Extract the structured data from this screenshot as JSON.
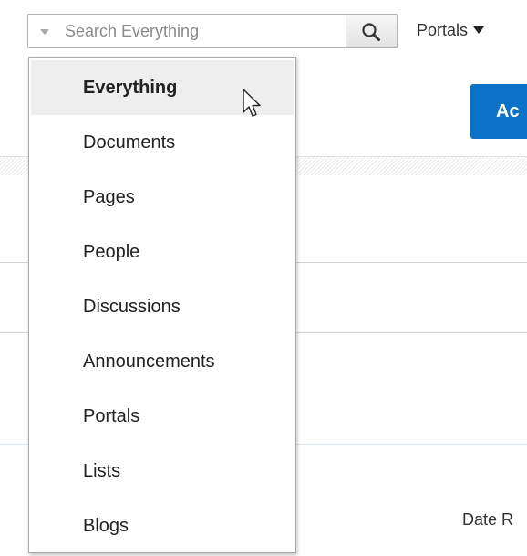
{
  "search": {
    "placeholder": "Search Everything",
    "value": ""
  },
  "portals_menu": {
    "label": "Portals"
  },
  "action_button": {
    "label": "Ac"
  },
  "date_label": "Date R",
  "scope_menu": {
    "selected_index": 0,
    "items": [
      {
        "label": "Everything"
      },
      {
        "label": "Documents"
      },
      {
        "label": "Pages"
      },
      {
        "label": "People"
      },
      {
        "label": "Discussions"
      },
      {
        "label": "Announcements"
      },
      {
        "label": "Portals"
      },
      {
        "label": "Lists"
      },
      {
        "label": "Blogs"
      }
    ]
  },
  "colors": {
    "accent": "#0b72c9",
    "menu_highlight": "#eeeeee"
  },
  "icons": {
    "search_button": "search-icon",
    "scope_toggle": "caret-down-icon",
    "portals_caret": "caret-down-icon",
    "cursor": "mouse-pointer-icon"
  }
}
